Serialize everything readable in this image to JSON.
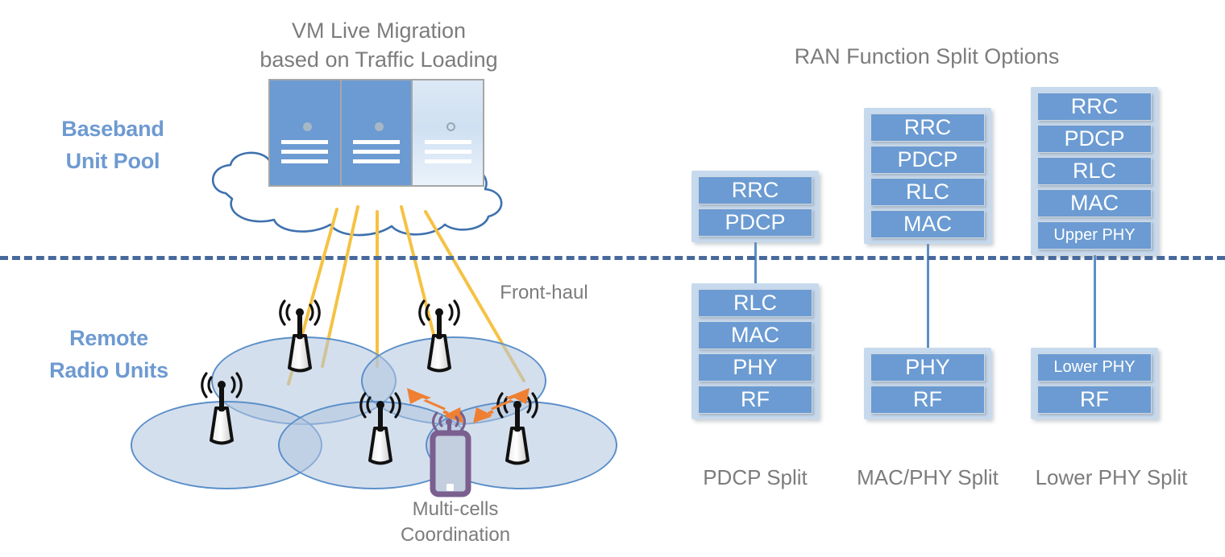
{
  "left_panel": {
    "top_title": "VM Live Migration\nbased on Traffic Loading",
    "top_title_line1": "VM Live Migration",
    "top_title_line2": "based on Traffic Loading",
    "baseband_label_line1": "Baseband",
    "baseband_label_line2": "Unit Pool",
    "remote_label_line1": "Remote",
    "remote_label_line2": "Radio Units",
    "fronthaul_label": "Front-haul",
    "multicell_label_line1": "Multi-cells",
    "multicell_label_line2": "Coordination",
    "server_units": [
      {
        "state": "active"
      },
      {
        "state": "active"
      },
      {
        "state": "migrating"
      }
    ],
    "fronthaul_link_count": 5,
    "antenna_count": 5,
    "cell_count": 5
  },
  "right_panel": {
    "title": "RAN Function Split Options",
    "splits": [
      {
        "caption": "PDCP Split",
        "upper_layers": [
          "RRC",
          "PDCP"
        ],
        "lower_layers": [
          "RLC",
          "MAC",
          "PHY",
          "RF"
        ]
      },
      {
        "caption": "MAC/PHY Split",
        "upper_layers": [
          "RRC",
          "PDCP",
          "RLC",
          "MAC"
        ],
        "lower_layers": [
          "PHY",
          "RF"
        ]
      },
      {
        "caption": "Lower PHY Split",
        "upper_layers": [
          "RRC",
          "PDCP",
          "RLC",
          "MAC",
          "Upper PHY"
        ],
        "lower_layers": [
          "Lower PHY",
          "RF"
        ]
      }
    ]
  },
  "colors": {
    "accent_blue": "#6b9bd2",
    "label_blue": "#6d9ad1",
    "stack_bg": "#c7d9ed",
    "divider": "#46689b",
    "fronthaul_yellow": "#f5c243",
    "arrow_orange": "#ef8033",
    "phone_purple": "#7a5f8f",
    "text_gray": "#7c7c7c",
    "cell_fill": "#b0c4de"
  }
}
